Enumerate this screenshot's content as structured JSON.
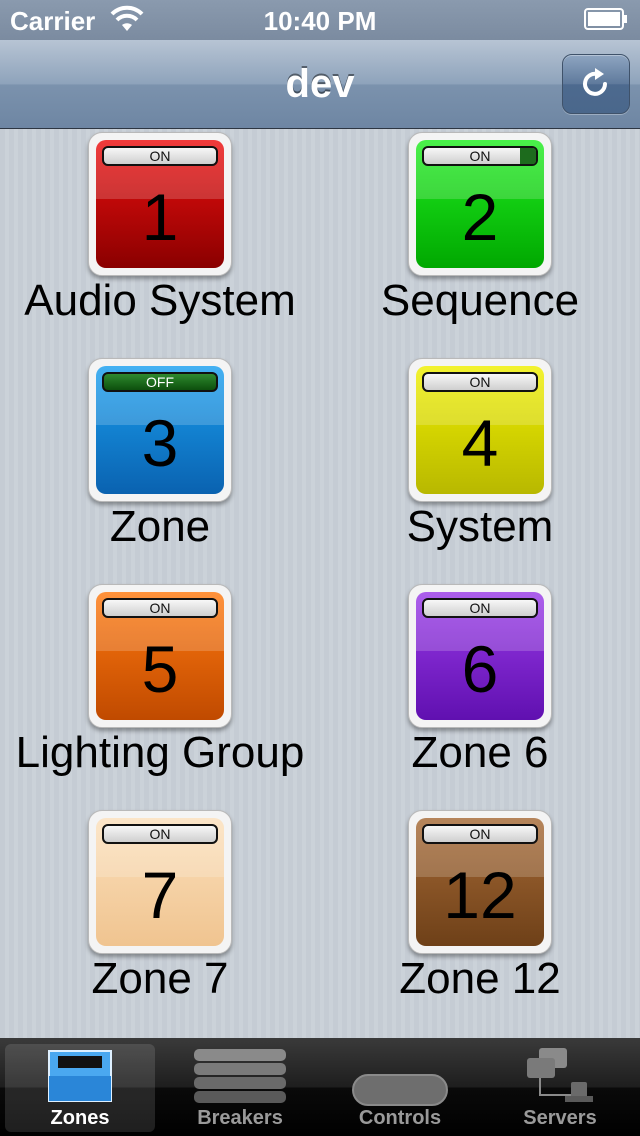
{
  "status_bar": {
    "carrier": "Carrier",
    "time": "10:40 PM"
  },
  "nav": {
    "title": "dev",
    "refresh_icon": "refresh-icon"
  },
  "zones": [
    {
      "number": "1",
      "name": "Audio System",
      "state": "ON",
      "color_top": "#ee1010",
      "color_bottom": "#8a0000"
    },
    {
      "number": "2",
      "name": "Sequence",
      "state": "ON",
      "color_top": "#22ee22",
      "color_bottom": "#00a800"
    },
    {
      "number": "3",
      "name": "Zone",
      "state": "OFF",
      "color_top": "#1aa0f0",
      "color_bottom": "#0a62b0"
    },
    {
      "number": "4",
      "name": "System",
      "state": "ON",
      "color_top": "#f0f000",
      "color_bottom": "#b8b800"
    },
    {
      "number": "5",
      "name": "Lighting Group",
      "state": "ON",
      "color_top": "#ff7a10",
      "color_bottom": "#c04a00"
    },
    {
      "number": "6",
      "name": "Zone 6",
      "state": "ON",
      "color_top": "#9a3be8",
      "color_bottom": "#6010b0"
    },
    {
      "number": "7",
      "name": "Zone 7",
      "state": "ON",
      "color_top": "#fbe0bc",
      "color_bottom": "#f0c490"
    },
    {
      "number": "12",
      "name": "Zone 12",
      "state": "ON",
      "color_top": "#a66a36",
      "color_bottom": "#6e4018"
    }
  ],
  "tabs": [
    {
      "label": "Zones",
      "icon": "zones-icon",
      "selected": true
    },
    {
      "label": "Breakers",
      "icon": "breakers-icon",
      "selected": false
    },
    {
      "label": "Controls",
      "icon": "controls-icon",
      "selected": false
    },
    {
      "label": "Servers",
      "icon": "servers-icon",
      "selected": false
    }
  ]
}
